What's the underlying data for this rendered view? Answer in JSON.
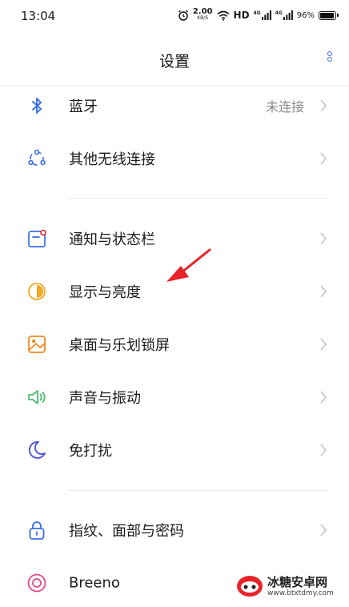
{
  "status_bar": {
    "time": "13:04",
    "net_speed_value": "2.00",
    "net_speed_unit": "KB/S",
    "hd_label": "HD",
    "sim1_tag": "4G",
    "sim2_tag": "4G",
    "battery_pct": "96%",
    "battery_level": 0.96
  },
  "header": {
    "title": "设置"
  },
  "rows": [
    {
      "label": "蓝牙",
      "value": "未连接",
      "icon": "bluetooth-icon",
      "color": "#3a6ee8"
    },
    {
      "label": "其他无线连接",
      "icon": "wireless-connections-icon",
      "color": "#3a6ee8"
    },
    {
      "label": "通知与状态栏",
      "icon": "notification-bar-icon",
      "color": "#3a6ee8"
    },
    {
      "label": "显示与亮度",
      "icon": "brightness-icon",
      "color": "#f5a623"
    },
    {
      "label": "桌面与乐划锁屏",
      "icon": "wallpaper-icon",
      "color": "#f08a24"
    },
    {
      "label": "声音与振动",
      "icon": "speaker-icon",
      "color": "#4cbb6c"
    },
    {
      "label": "免打扰",
      "icon": "moon-icon",
      "color": "#4a56d8"
    },
    {
      "label": "指纹、面部与密码",
      "icon": "lock-icon",
      "color": "#3a6ee8"
    },
    {
      "label": "Breeno",
      "icon": "breeno-icon",
      "color": "#e04a8c"
    }
  ],
  "watermark": {
    "brand": "冰糖安卓网",
    "url": "www.btxtdmy.com"
  },
  "colors": {
    "annotation_arrow": "#e8242a",
    "divider": "#ececec",
    "chevron": "#c4c4c4"
  }
}
